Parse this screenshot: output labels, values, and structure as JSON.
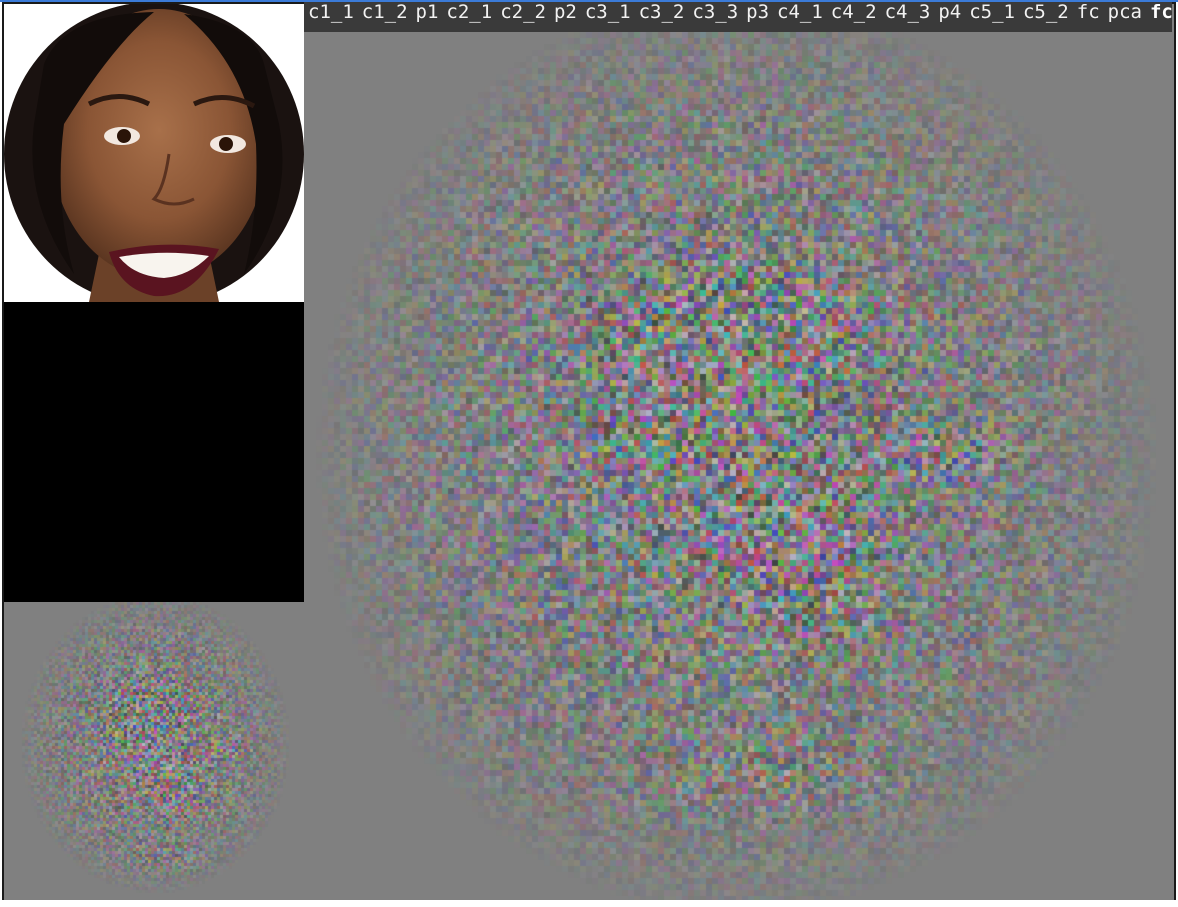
{
  "layers": {
    "items": [
      {
        "label": "c1_1",
        "active": false
      },
      {
        "label": "c1_2",
        "active": false
      },
      {
        "label": "p1",
        "active": false
      },
      {
        "label": "c2_1",
        "active": false
      },
      {
        "label": "c2_2",
        "active": false
      },
      {
        "label": "p2",
        "active": false
      },
      {
        "label": "c3_1",
        "active": false
      },
      {
        "label": "c3_2",
        "active": false
      },
      {
        "label": "c3_3",
        "active": false
      },
      {
        "label": "p3",
        "active": false
      },
      {
        "label": "c4_1",
        "active": false
      },
      {
        "label": "c4_2",
        "active": false
      },
      {
        "label": "c4_3",
        "active": false
      },
      {
        "label": "p4",
        "active": false
      },
      {
        "label": "c5_1",
        "active": false
      },
      {
        "label": "c5_2",
        "active": false
      },
      {
        "label": "fc",
        "active": false
      },
      {
        "label": "pca",
        "active": false
      },
      {
        "label": "fc_out",
        "active": true
      }
    ]
  },
  "colors": {
    "layer_bar_bg": "#3a3a3a",
    "viz_background": "#808080",
    "activation_bg": "#000000"
  },
  "status": {
    "text": ""
  }
}
